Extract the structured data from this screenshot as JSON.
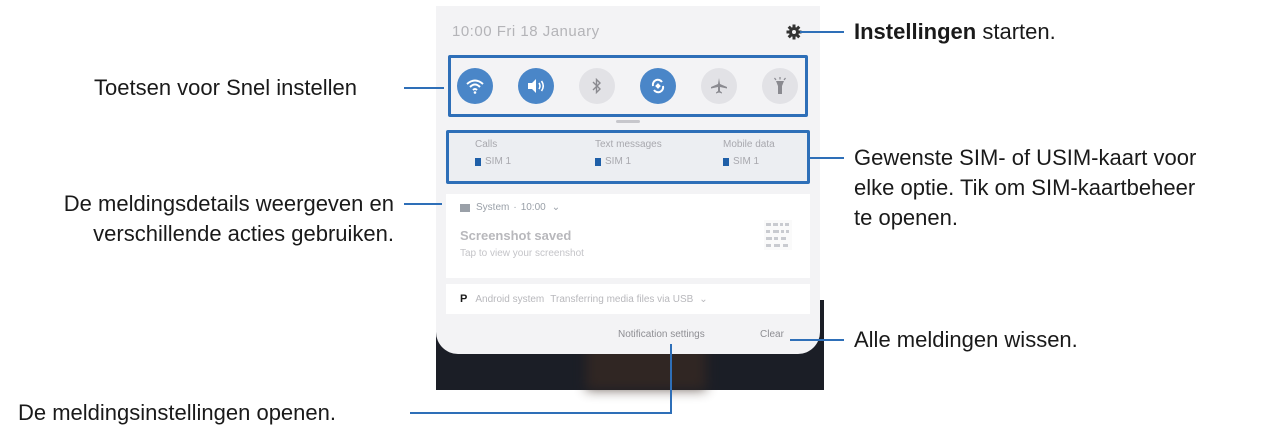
{
  "callouts": {
    "settings_bold": "Instellingen",
    "settings_rest": " starten.",
    "quick_settings": "Toetsen voor Snel instellen",
    "sim_line1": "Gewenste SIM- of USIM-kaart voor",
    "sim_line2": "elke optie. Tik om SIM-kaartbeheer",
    "sim_line3": "te openen.",
    "details_line1": "De meldingsdetails weergeven en",
    "details_line2": "verschillende acties gebruiken.",
    "clear_all": "Alle meldingen wissen.",
    "notif_settings": "De meldingsinstellingen openen."
  },
  "phone": {
    "status_date": "10:00  Fri 18 January",
    "quick_settings": [
      {
        "icon": "wifi-icon",
        "active": true
      },
      {
        "icon": "sound-icon",
        "active": true
      },
      {
        "icon": "bluetooth-icon",
        "active": false
      },
      {
        "icon": "auto-rotate-icon",
        "active": true
      },
      {
        "icon": "airplane-icon",
        "active": false
      },
      {
        "icon": "flashlight-icon",
        "active": false
      }
    ],
    "sim": [
      {
        "label": "Calls",
        "value": "SIM 1"
      },
      {
        "label": "Text messages",
        "value": "SIM 1"
      },
      {
        "label": "Mobile data",
        "value": "SIM 1"
      }
    ],
    "notification": {
      "app": "System",
      "time": "10:00",
      "title": "Screenshot saved",
      "text": "Tap to view your screenshot"
    },
    "notification2": {
      "app": "Android system",
      "text": "Transferring media files via USB"
    },
    "actions": {
      "notification_settings": "Notification settings",
      "clear": "Clear"
    }
  },
  "colors": {
    "accent": "#2e6fb8",
    "toggle_on": "#4a86c8"
  }
}
